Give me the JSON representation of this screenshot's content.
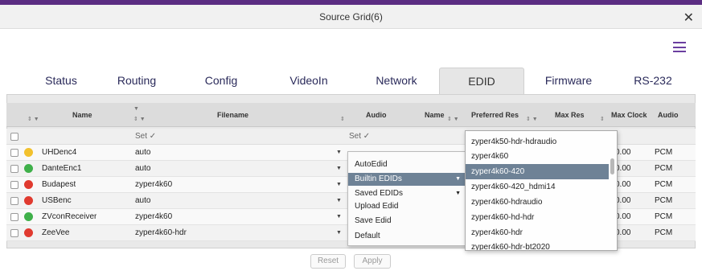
{
  "window": {
    "title": "Source Grid(6)",
    "close_glyph": "✕"
  },
  "tabs": [
    {
      "label": "Status"
    },
    {
      "label": "Routing"
    },
    {
      "label": "Config"
    },
    {
      "label": "VideoIn"
    },
    {
      "label": "Network"
    },
    {
      "label": "EDID",
      "active": true
    },
    {
      "label": "Firmware"
    },
    {
      "label": "RS-232"
    }
  ],
  "table": {
    "headers": {
      "name": "Name",
      "filename": "Filename",
      "audio": "Audio",
      "name2": "Name",
      "preferred_res": "Preferred Res",
      "max_res": "Max Res",
      "max_clock": "Max Clock",
      "audio2": "Audio"
    },
    "set_label": "Set ✓",
    "set_label2": "Set ✓",
    "rows": [
      {
        "name": "UHDenc4",
        "status": "yellow",
        "filename": "auto",
        "clock": "0.00",
        "audio": "PCM"
      },
      {
        "name": "DanteEnc1",
        "status": "green",
        "filename": "auto",
        "clock": "0.00",
        "audio": "PCM"
      },
      {
        "name": "Budapest",
        "status": "red",
        "filename": "zyper4k60",
        "clock": "0.00",
        "audio": "PCM"
      },
      {
        "name": "USBenc",
        "status": "red",
        "filename": "auto",
        "clock": "0.00",
        "audio": "PCM"
      },
      {
        "name": "ZVconReceiver",
        "status": "green",
        "filename": "zyper4k60",
        "clock": "0.00",
        "audio": "PCM"
      },
      {
        "name": "ZeeVee",
        "status": "red",
        "filename": "zyper4k60-hdr",
        "clock": "0.00",
        "audio": "PCM"
      }
    ]
  },
  "edid_menu": {
    "items": [
      "AutoEdid",
      "Builtin EDIDs",
      "Saved EDIDs",
      "Upload Edid",
      "Save Edid",
      "Default"
    ],
    "selected_index": 1
  },
  "builtin_list": {
    "items": [
      "zyper4k50-hdr-hdraudio",
      "zyper4k60",
      "zyper4k60-420",
      "zyper4k60-420_hdmi14",
      "zyper4k60-hdraudio",
      "zyper4k60-hd-hdr",
      "zyper4k60-hdr",
      "zyper4k60-hdr-bt2020"
    ],
    "selected_index": 2
  },
  "buttons": {
    "reset": "Reset",
    "apply": "Apply"
  },
  "colors": {
    "accent": "#5b2d82",
    "yellow": "#f2c12e",
    "green": "#3fb04a",
    "red": "#e03a2f",
    "menu_select": "#6e8296"
  },
  "icons": {
    "hamburger": "menu-icon",
    "close": "close-icon"
  }
}
